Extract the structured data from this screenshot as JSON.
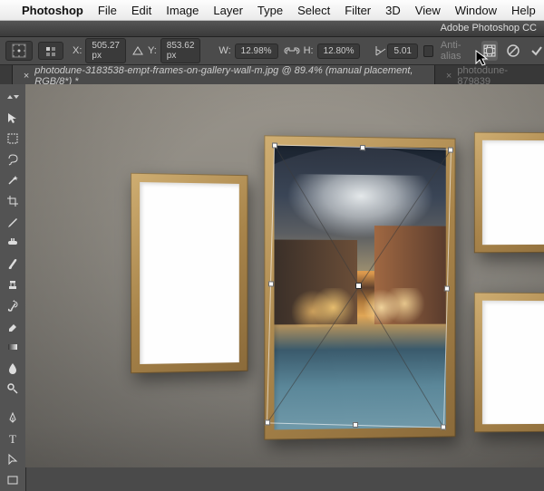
{
  "menubar": {
    "items": [
      "Photoshop",
      "File",
      "Edit",
      "Image",
      "Layer",
      "Type",
      "Select",
      "Filter",
      "3D",
      "View",
      "Window",
      "Help"
    ]
  },
  "titlebar": {
    "app": "Adobe Photoshop CC"
  },
  "options": {
    "x_label": "X:",
    "x": "505.27 px",
    "y_label": "Y:",
    "853.62 px": "853.62 px",
    "y": "853.62 px",
    "w_label": "W:",
    "w": "12.98%",
    "h_label": "H:",
    "h": "12.80%",
    "rot": "5.01",
    "anti_alias": "Anti-alias"
  },
  "tabs": {
    "active": "photodune-3183538-empt-frames-on-gallery-wall-m.jpg @ 89.4% (manual placement, RGB/8*) *",
    "inactive": "photodune-879839"
  }
}
